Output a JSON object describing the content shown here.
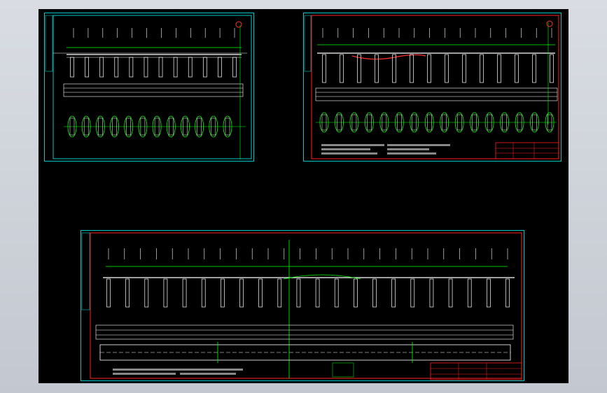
{
  "viewer": {
    "background_color": "#000000",
    "frame_color": "#c9cdd4"
  },
  "colors": {
    "border_outer": "#00c8c8",
    "border_inner": "#ff2020",
    "structure": "#ffffff",
    "dimension": "#00ff00",
    "highlight": "#ff3030"
  },
  "sheets": [
    {
      "id": "sheet-1",
      "pier_count": 12,
      "section_count": 12
    },
    {
      "id": "sheet-2",
      "pier_count": 14,
      "section_count": 16
    },
    {
      "id": "sheet-3",
      "pier_count": 22
    }
  ]
}
